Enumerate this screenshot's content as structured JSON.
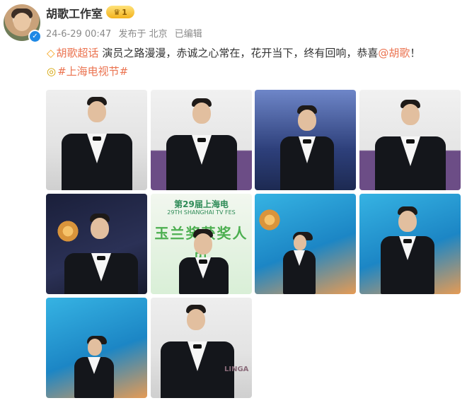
{
  "post": {
    "author_name": "胡歌工作室",
    "vip_badge_level": "1",
    "timestamp": "24-6-29 00:47",
    "location": "发布于 北京",
    "edited": "已编辑",
    "topic_link": "胡歌超话",
    "text": "演员之路漫漫，赤诚之心常在，花开当下，终有回响，恭喜",
    "mention": "@胡歌",
    "text_end": "！",
    "hashtag": "#上海电视节#"
  },
  "photos": {
    "poster_banner": "第29届上海电",
    "poster_banner_en": "29TH SHANGHAI TV FES",
    "poster_award": "玉兰奖获奖人员",
    "backdrop_text": "LINGA"
  },
  "icons": {
    "verified": "verified-badge-icon",
    "vip": "crown-vip-icon",
    "topic": "diamond-topic-icon",
    "hashtag": "tv-topic-icon"
  },
  "colors": {
    "link": "#eb7350",
    "verified": "#1e88e5"
  }
}
